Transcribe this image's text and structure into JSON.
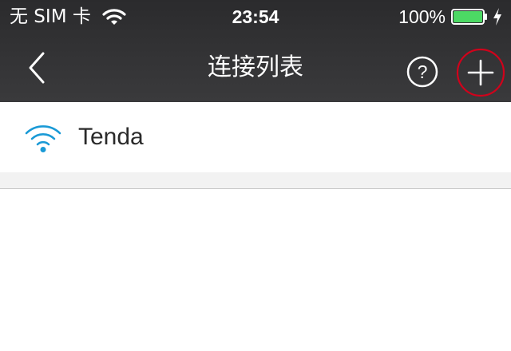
{
  "status_bar": {
    "carrier": "无 SIM 卡",
    "time": "23:54",
    "battery_percent": "100%",
    "battery_level": 1.0,
    "battery_color": "#4cd964",
    "charging": true
  },
  "nav_bar": {
    "title": "连接列表",
    "back_icon": "chevron-left-icon",
    "help_icon": "question-circle-icon",
    "add_icon": "plus-icon",
    "add_highlight_color": "#d0021b"
  },
  "connections": [
    {
      "name": "Tenda",
      "icon": "wifi-icon",
      "icon_color": "#1a9ad6"
    }
  ]
}
